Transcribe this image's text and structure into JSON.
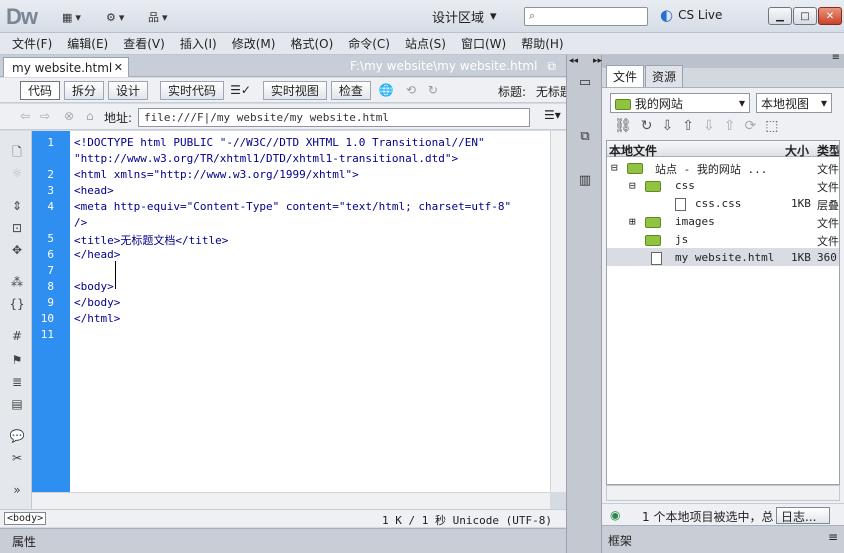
{
  "app": {
    "logo": "Dw",
    "workspace": "设计区域",
    "cslive": "CS Live"
  },
  "menu": [
    "文件(F)",
    "编辑(E)",
    "查看(V)",
    "插入(I)",
    "修改(M)",
    "格式(O)",
    "命令(C)",
    "站点(S)",
    "窗口(W)",
    "帮助(H)"
  ],
  "document": {
    "tab_label": "my website.html",
    "path": "F:\\my website\\my website.html"
  },
  "viewbar": {
    "code": "代码",
    "split": "拆分",
    "design": "设计",
    "live_code": "实时代码",
    "live_view": "实时视图",
    "inspect": "检查",
    "title_label": "标题:",
    "title_value": "无标题"
  },
  "address": {
    "label": "地址:",
    "value": "file:///F|/my website/my website.html"
  },
  "code_lines": [
    {
      "n": "1",
      "text": "<!DOCTYPE html PUBLIC \"-//W3C//DTD XHTML 1.0 Transitional//EN\""
    },
    {
      "n": "",
      "text": "\"http://www.w3.org/TR/xhtml1/DTD/xhtml1-transitional.dtd\">"
    },
    {
      "n": "2",
      "text": "<html xmlns=\"http://www.w3.org/1999/xhtml\">"
    },
    {
      "n": "3",
      "text": "<head>"
    },
    {
      "n": "4",
      "text": "<meta http-equiv=\"Content-Type\" content=\"text/html; charset=utf-8\""
    },
    {
      "n": "",
      "text": "/>"
    },
    {
      "n": "5",
      "text": "<title>无标题文档</title>"
    },
    {
      "n": "6",
      "text": "</head>"
    },
    {
      "n": "7",
      "text": ""
    },
    {
      "n": "8",
      "text": "<body>"
    },
    {
      "n": "9",
      "text": "</body>"
    },
    {
      "n": "10",
      "text": "</html>"
    },
    {
      "n": "11",
      "text": ""
    }
  ],
  "status": {
    "tag": "<body>",
    "encoding": "1 K / 1 秒 Unicode (UTF-8)"
  },
  "properties_label": "属性",
  "panel": {
    "tab_files": "文件",
    "tab_assets": "资源",
    "site": "我的网站",
    "view": "本地视图",
    "col_local": "本地文件",
    "col_size": "大小",
    "col_type": "类型",
    "files": [
      {
        "name": "站点 - 我的网站 ...",
        "size": "",
        "type": "文件"
      },
      {
        "name": "css",
        "size": "",
        "type": "文件"
      },
      {
        "name": "css.css",
        "size": "1KB",
        "type": "层叠"
      },
      {
        "name": "images",
        "size": "",
        "type": "文件"
      },
      {
        "name": "js",
        "size": "",
        "type": "文件"
      },
      {
        "name": "my website.html",
        "size": "1KB",
        "type": "360"
      }
    ],
    "status_text": "1 个本地项目被选中，总",
    "log_button": "日志...",
    "frame_label": "框架"
  },
  "colors": {
    "gutter": "#2e8ff0",
    "folder": "#8fc340"
  }
}
